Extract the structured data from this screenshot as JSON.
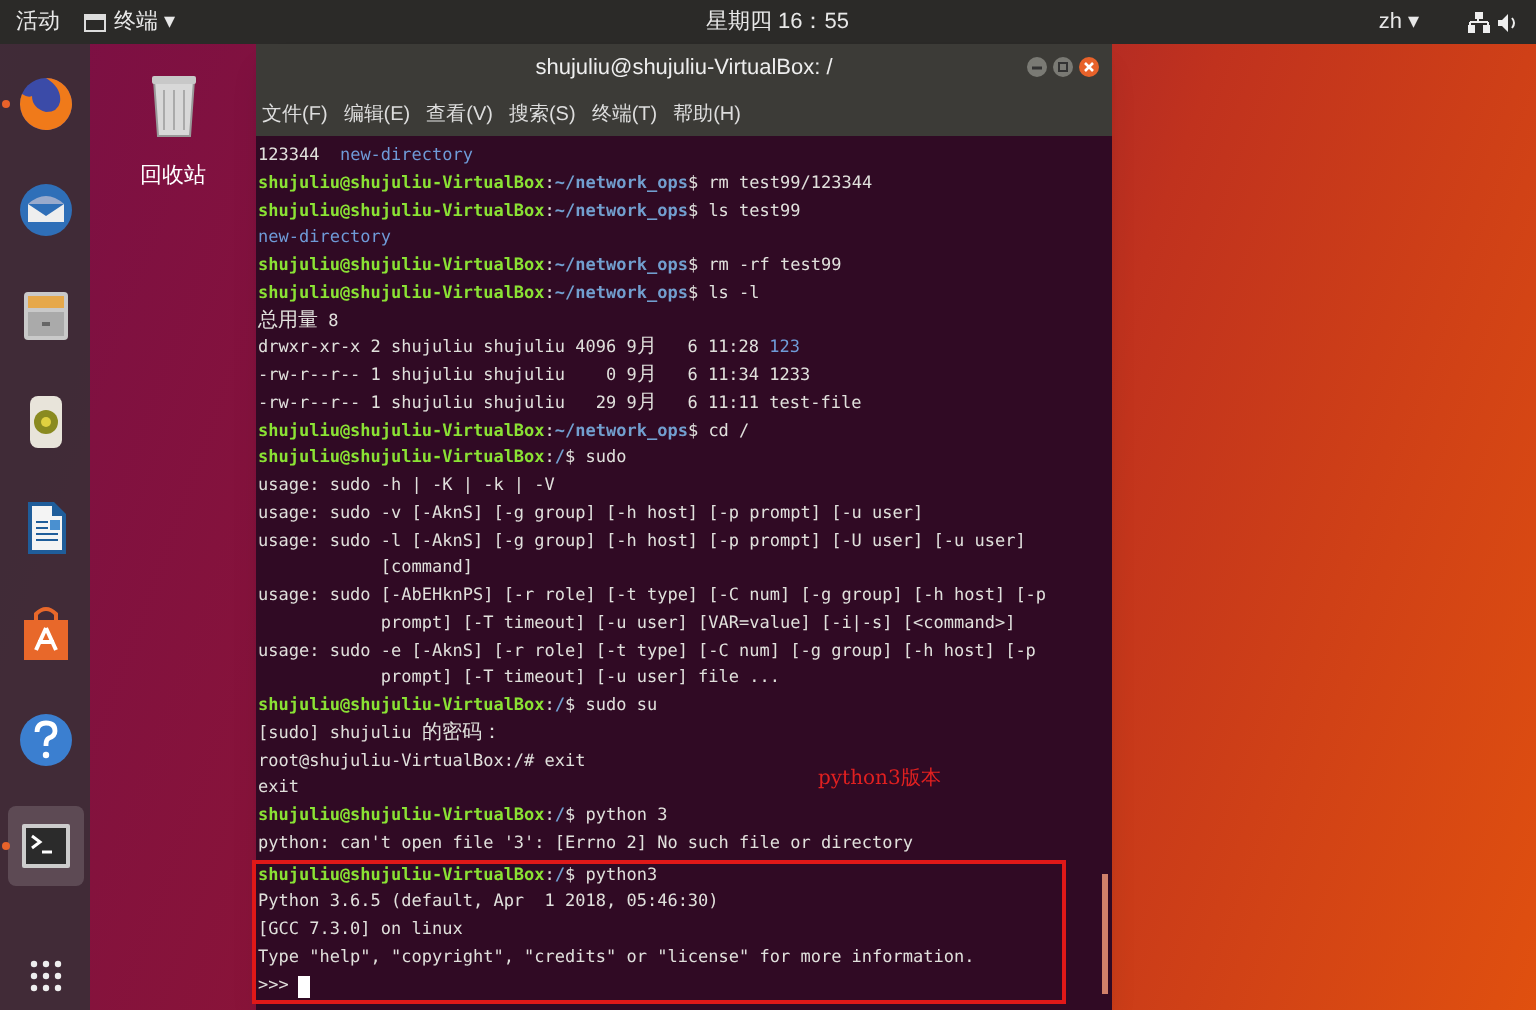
{
  "top_bar": {
    "activities": "活动",
    "app_menu": "终端 ▾",
    "clock": "星期四 16：55",
    "input_method": "zh ▾"
  },
  "dock": {
    "items": [
      {
        "kind": "firefox",
        "running": true,
        "selected": false
      },
      {
        "kind": "mail",
        "running": false,
        "selected": false
      },
      {
        "kind": "files",
        "running": false,
        "selected": false
      },
      {
        "kind": "speaker",
        "running": false,
        "selected": false
      },
      {
        "kind": "document",
        "running": false,
        "selected": false
      },
      {
        "kind": "store",
        "running": false,
        "selected": false
      },
      {
        "kind": "help",
        "running": false,
        "selected": false
      },
      {
        "kind": "terminal",
        "running": true,
        "selected": true
      }
    ]
  },
  "desktop": {
    "trash_label": "回收站"
  },
  "window": {
    "title": "shujuliu@shujuliu-VirtualBox: /",
    "menu": [
      "文件(F)",
      "编辑(E)",
      "查看(V)",
      "搜索(S)",
      "终端(T)",
      "帮助(H)"
    ],
    "lines": [
      {
        "kind": "output",
        "segments": [
          {
            "text": "123344  ",
            "kind": "plain"
          },
          {
            "text": "new-directory",
            "kind": "dir"
          }
        ],
        "highlighted": false
      },
      {
        "kind": "prompt",
        "user": "shujuliu@shujuliu-VirtualBox",
        "separator": ":",
        "path": "~/network_ops",
        "command": "$ rm test99/123344",
        "highlighted": false
      },
      {
        "kind": "prompt",
        "user": "shujuliu@shujuliu-VirtualBox",
        "separator": ":",
        "path": "~/network_ops",
        "command": "$ ls test99",
        "highlighted": false
      },
      {
        "kind": "output",
        "segments": [
          {
            "text": "new-directory",
            "kind": "dir"
          }
        ],
        "highlighted": false
      },
      {
        "kind": "prompt",
        "user": "shujuliu@shujuliu-VirtualBox",
        "separator": ":",
        "path": "~/network_ops",
        "command": "$ rm -rf test99",
        "highlighted": false
      },
      {
        "kind": "prompt",
        "user": "shujuliu@shujuliu-VirtualBox",
        "separator": ":",
        "path": "~/network_ops",
        "command": "$ ls -l",
        "highlighted": false
      },
      {
        "kind": "output",
        "segments": [
          {
            "text": "总用量 8",
            "kind": "plain"
          }
        ],
        "highlighted": false
      },
      {
        "kind": "output",
        "segments": [
          {
            "text": "drwxr-xr-x 2 shujuliu shujuliu 4096 9月   6 11:28 ",
            "kind": "plain"
          },
          {
            "text": "123",
            "kind": "dir"
          }
        ],
        "highlighted": false
      },
      {
        "kind": "output",
        "segments": [
          {
            "text": "-rw-r--r-- 1 shujuliu shujuliu    0 9月   6 11:34 1233",
            "kind": "plain"
          }
        ],
        "highlighted": false
      },
      {
        "kind": "output",
        "segments": [
          {
            "text": "-rw-r--r-- 1 shujuliu shujuliu   29 9月   6 11:11 test-file",
            "kind": "plain"
          }
        ],
        "highlighted": false
      },
      {
        "kind": "prompt",
        "user": "shujuliu@shujuliu-VirtualBox",
        "separator": ":",
        "path": "~/network_ops",
        "command": "$ cd /",
        "highlighted": false
      },
      {
        "kind": "prompt",
        "user": "shujuliu@shujuliu-VirtualBox",
        "separator": ":",
        "path": "/",
        "command": "$ sudo",
        "highlighted": false
      },
      {
        "kind": "output",
        "segments": [
          {
            "text": "usage: sudo -h | -K | -k | -V",
            "kind": "plain"
          }
        ],
        "highlighted": false
      },
      {
        "kind": "output",
        "segments": [
          {
            "text": "usage: sudo -v [-AknS] [-g group] [-h host] [-p prompt] [-u user]",
            "kind": "plain"
          }
        ],
        "highlighted": false
      },
      {
        "kind": "output",
        "segments": [
          {
            "text": "usage: sudo -l [-AknS] [-g group] [-h host] [-p prompt] [-U user] [-u user]",
            "kind": "plain"
          }
        ],
        "highlighted": false
      },
      {
        "kind": "continuation",
        "segments": [
          {
            "text": "[command]",
            "kind": "plain"
          }
        ],
        "highlighted": false
      },
      {
        "kind": "output",
        "segments": [
          {
            "text": "usage: sudo [-AbEHknPS] [-r role] [-t type] [-C num] [-g group] [-h host] [-p",
            "kind": "plain"
          }
        ],
        "highlighted": false
      },
      {
        "kind": "continuation",
        "segments": [
          {
            "text": "prompt] [-T timeout] [-u user] [VAR=value] [-i|-s] [<command>]",
            "kind": "plain"
          }
        ],
        "highlighted": false
      },
      {
        "kind": "output",
        "segments": [
          {
            "text": "usage: sudo -e [-AknS] [-r role] [-t type] [-C num] [-g group] [-h host] [-p",
            "kind": "plain"
          }
        ],
        "highlighted": false
      },
      {
        "kind": "continuation",
        "segments": [
          {
            "text": "prompt] [-T timeout] [-u user] file ...",
            "kind": "plain"
          }
        ],
        "highlighted": false
      },
      {
        "kind": "prompt",
        "user": "shujuliu@shujuliu-VirtualBox",
        "separator": ":",
        "path": "/",
        "command": "$ sudo su",
        "highlighted": false
      },
      {
        "kind": "output",
        "segments": [
          {
            "text": "[sudo] shujuliu 的密码：",
            "kind": "plain"
          }
        ],
        "highlighted": false
      },
      {
        "kind": "output",
        "segments": [
          {
            "text": "root@shujuliu-VirtualBox:/# exit",
            "kind": "plain"
          }
        ],
        "highlighted": false
      },
      {
        "kind": "output",
        "segments": [
          {
            "text": "exit",
            "kind": "plain"
          }
        ],
        "highlighted": false
      },
      {
        "kind": "prompt",
        "user": "shujuliu@shujuliu-VirtualBox",
        "separator": ":",
        "path": "/",
        "command": "$ python 3",
        "highlighted": false
      },
      {
        "kind": "output",
        "segments": [
          {
            "text": "python: can't open file '3': [Errno 2] No such file or directory",
            "kind": "plain"
          }
        ],
        "highlighted": false
      },
      {
        "kind": "prompt",
        "user": "shujuliu@shujuliu-VirtualBox",
        "separator": ":",
        "path": "/",
        "command": "$ python3",
        "highlighted": true
      },
      {
        "kind": "output",
        "segments": [
          {
            "text": "Python 3.6.5 (default, Apr  1 2018, 05:46:30)",
            "kind": "plain"
          }
        ],
        "highlighted": true
      },
      {
        "kind": "output",
        "segments": [
          {
            "text": "[GCC 7.3.0] on linux",
            "kind": "plain"
          }
        ],
        "highlighted": true
      },
      {
        "kind": "output",
        "segments": [
          {
            "text": "Type \"help\", \"copyright\", \"credits\" or \"license\" for more information.",
            "kind": "plain"
          }
        ],
        "highlighted": true
      },
      {
        "kind": "input",
        "segments": [
          {
            "text": ">>> ",
            "kind": "plain"
          }
        ],
        "highlighted": true
      }
    ],
    "annotation": "python3版本"
  }
}
